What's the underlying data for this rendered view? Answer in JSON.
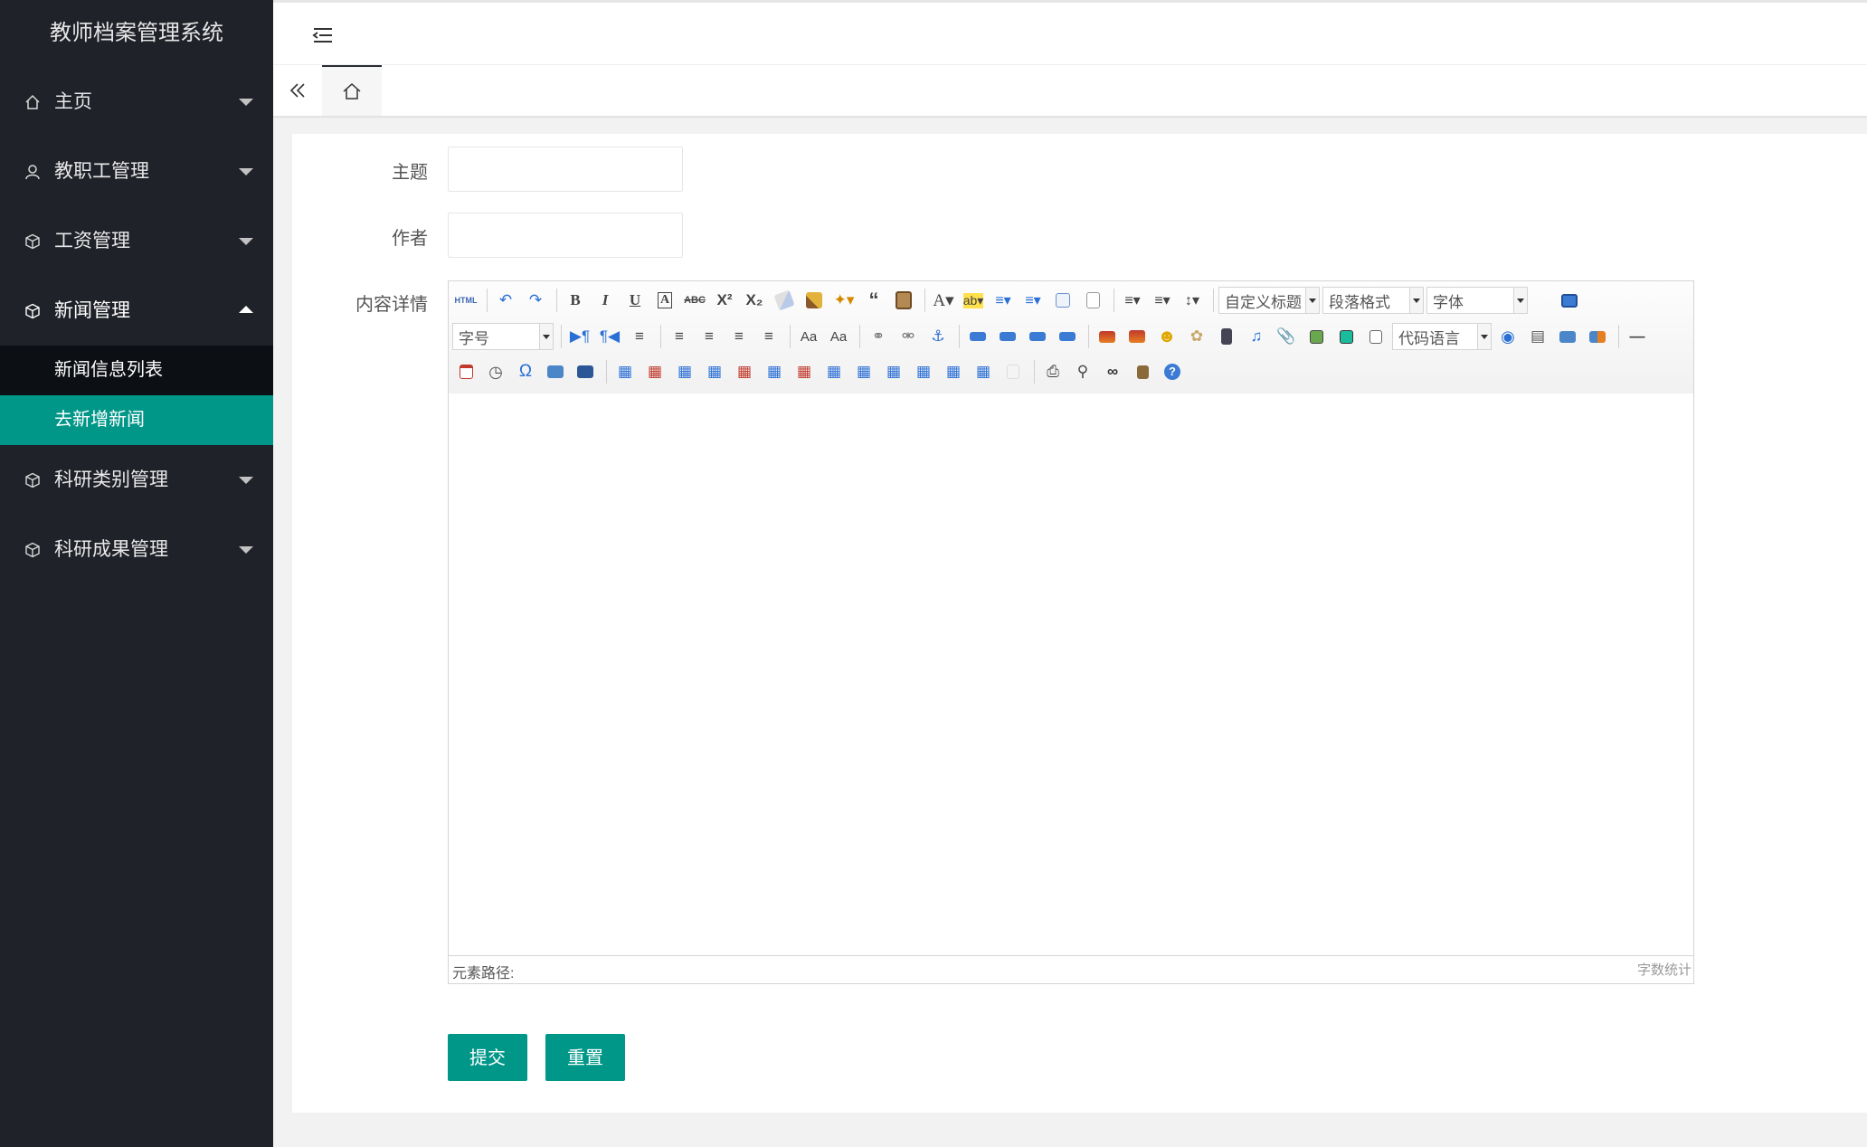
{
  "app": {
    "title": "教师档案管理系统"
  },
  "sidebar": {
    "items": [
      {
        "label": "主页",
        "icon": "home-icon"
      },
      {
        "label": "教职工管理",
        "icon": "user-icon"
      },
      {
        "label": "工资管理",
        "icon": "cube-icon"
      },
      {
        "label": "新闻管理",
        "icon": "cube-icon",
        "expanded": true,
        "children": [
          {
            "label": "新闻信息列表",
            "active": false
          },
          {
            "label": "去新增新闻",
            "active": true
          }
        ]
      },
      {
        "label": "科研类别管理",
        "icon": "cube-icon"
      },
      {
        "label": "科研成果管理",
        "icon": "cube-icon"
      }
    ]
  },
  "tabs": [
    {
      "name": "home",
      "icon": "home-icon",
      "active": true
    }
  ],
  "form": {
    "subject_label": "主题",
    "subject_value": "",
    "author_label": "作者",
    "author_value": "",
    "content_label": "内容详情"
  },
  "editor": {
    "dropdowns": {
      "custom_heading": "自定义标题",
      "paragraph_format": "段落格式",
      "font_family": "字体",
      "font_size": "字号",
      "code_language": "代码语言"
    },
    "html_button": "HTML",
    "element_path_label": "元素路径:",
    "word_count_label": "字数统计"
  },
  "buttons": {
    "submit": "提交",
    "reset": "重置"
  },
  "colors": {
    "sidebar_bg": "#20222a",
    "accent": "#009688",
    "submenu_bg": "#0c0f13"
  }
}
